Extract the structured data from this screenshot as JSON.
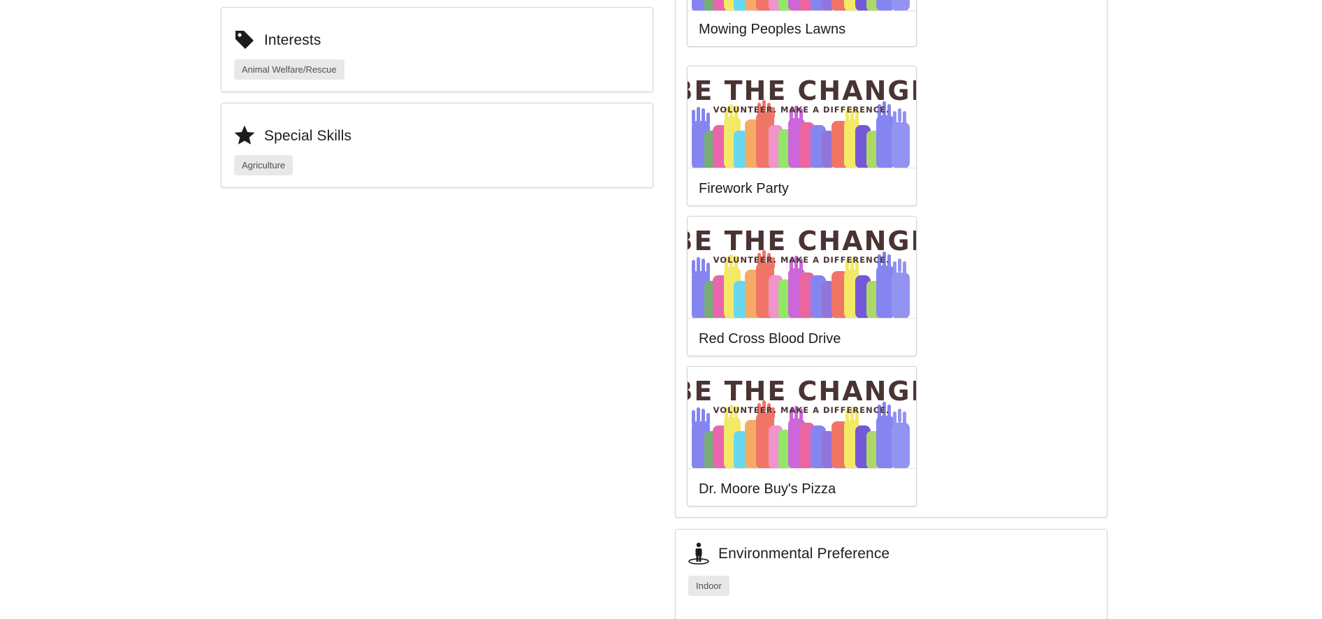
{
  "interests": {
    "title": "Interests",
    "icon": "tag-icon",
    "tags": [
      "Animal Welfare/Rescue"
    ]
  },
  "special_skills": {
    "title": "Special Skills",
    "icon": "star-icon",
    "tags": [
      "Agriculture"
    ]
  },
  "banner": {
    "headline": "BE THE CHANGE",
    "subline": "VOLUNTEER. MAKE A DIFFERENCE.",
    "headline_color": "#4a3333"
  },
  "events": [
    {
      "title": "Mowing Peoples Lawns"
    },
    {
      "title": "Firework Party"
    },
    {
      "title": "Red Cross Blood Drive"
    },
    {
      "title": "Dr. Moore Buy's Pizza"
    }
  ],
  "environmental_preference": {
    "title": "Environmental Preference",
    "icon": "person-standing-icon",
    "tags": [
      "Indoor"
    ]
  }
}
